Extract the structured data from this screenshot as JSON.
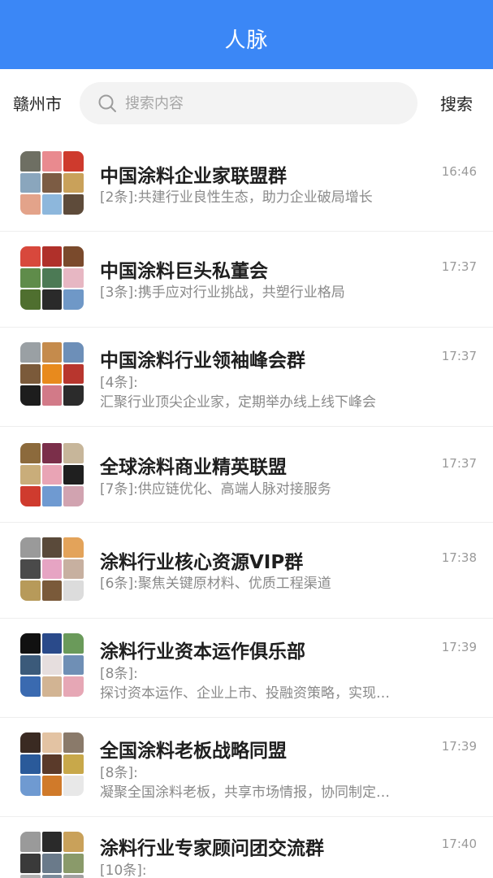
{
  "header": {
    "title": "人脉"
  },
  "search": {
    "city": "赣州市",
    "placeholder": "搜索内容",
    "button_label": "搜索"
  },
  "colors": {
    "accent": "#3b87f6"
  },
  "groups": [
    {
      "name": "中国涂料企业家联盟群",
      "time": "16:46",
      "desc_prefix": "[2条]:",
      "desc_text": "共建行业良性生态，助力企业破局增长"
    },
    {
      "name": "中国涂料巨头私董会",
      "time": "17:37",
      "desc_prefix": "[3条]:",
      "desc_text": "携手应对行业挑战，共塑行业格局"
    },
    {
      "name": "中国涂料行业领袖峰会群",
      "time": "17:37",
      "desc_prefix": "[4条]:",
      "desc_text": "汇聚行业顶尖企业家，定期举办线上线下峰会"
    },
    {
      "name": "全球涂料商业精英联盟",
      "time": "17:37",
      "desc_prefix": "[7条]:",
      "desc_text": "供应链优化、高端人脉对接服务"
    },
    {
      "name": "涂料行业核心资源VIP群",
      "time": "17:38",
      "desc_prefix": "[6条]:",
      "desc_text": "聚焦关键原材料、优质工程渠道"
    },
    {
      "name": "涂料行业资本运作俱乐部",
      "time": "17:39",
      "desc_prefix": "[8条]:",
      "desc_text": "探讨资本运作、企业上市、投融资策略，实现…"
    },
    {
      "name": "全国涂料老板战略同盟",
      "time": "17:39",
      "desc_prefix": "[8条]:",
      "desc_text": "凝聚全国涂料老板，共享市场情报，协同制定…"
    },
    {
      "name": "涂料行业专家顾问团交流群",
      "time": "17:40",
      "desc_prefix": "[10条]:",
      "desc_text": ""
    }
  ]
}
